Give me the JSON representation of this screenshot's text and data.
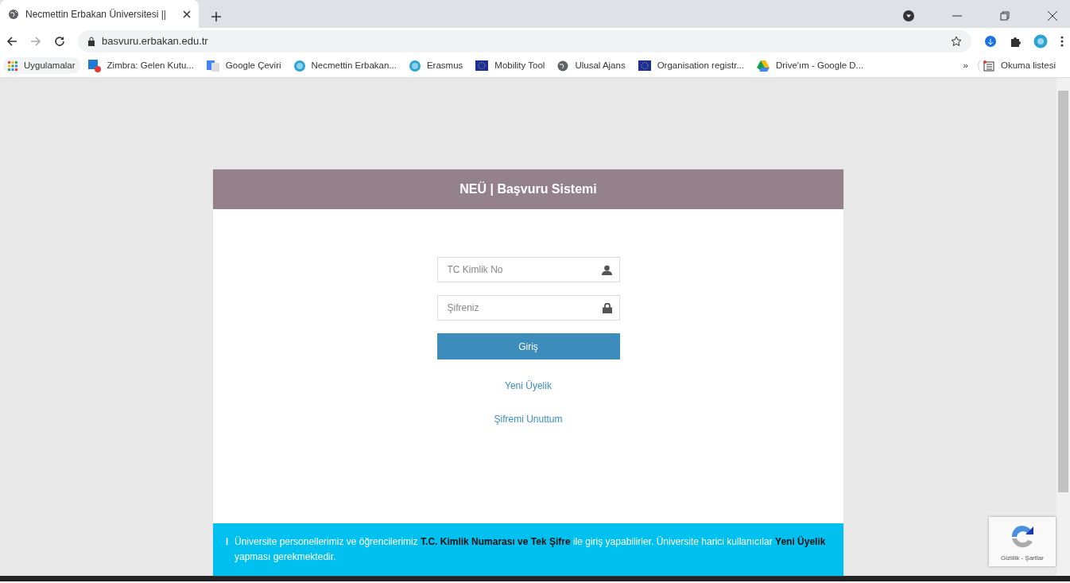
{
  "browser": {
    "tab_title": "Necmettin Erbakan Üniversitesi ||",
    "url": "basvuru.erbakan.edu.tr",
    "bookmarks": [
      {
        "label": "Uygulamalar",
        "kind": "apps"
      },
      {
        "label": "Zimbra: Gelen Kutu...",
        "kind": "zimbra"
      },
      {
        "label": "Google Çeviri",
        "kind": "translate"
      },
      {
        "label": "Necmettin Erbakan...",
        "kind": "seal"
      },
      {
        "label": "Erasmus",
        "kind": "seal"
      },
      {
        "label": "Mobility Tool",
        "kind": "eu"
      },
      {
        "label": "Ulusal Ajans",
        "kind": "globe"
      },
      {
        "label": "Organisation registr...",
        "kind": "eu"
      },
      {
        "label": "Drive'ım - Google D...",
        "kind": "drive"
      }
    ],
    "overflow": "»",
    "reading_list": "Okuma listesi"
  },
  "login": {
    "title": "NEÜ | Başvuru Sistemi",
    "id_field": {
      "placeholder": "TC Kimlik No"
    },
    "password_field": {
      "placeholder": "Şifreniz"
    },
    "submit": "Giriş",
    "links": [
      "Yeni Üyelik",
      "Şifremi Unuttum"
    ]
  },
  "notice": {
    "icon": "ℹ",
    "text": "Üniversite personellerimiz ve öğrencilerimiz **T.C. Kimlik Numarası ve Tek Şifre** ile giriş yapabilirler. Üniversite harici kullanıcılar **Yeni Üyelik** yapması gerekmektedir."
  },
  "recaptcha": {
    "links": "Gizlilik - Şartlar"
  }
}
